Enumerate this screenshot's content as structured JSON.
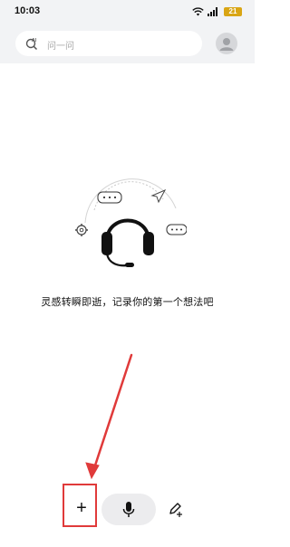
{
  "status_bar": {
    "time": "10:03",
    "battery": "21",
    "icons": [
      "wifi-icon",
      "signal-icon",
      "battery-icon"
    ]
  },
  "header": {
    "search": {
      "icon": "ai-search-icon",
      "placeholder": "问一问"
    },
    "avatar": {
      "icon": "user-avatar-icon"
    }
  },
  "main": {
    "empty_state_text": "灵感转瞬即逝，记录你的第一个想法吧",
    "illustration": "headphones-icon"
  },
  "bottom_bar": {
    "add_label": "+",
    "mic_icon": "microphone-icon",
    "pen_icon": "pen-text-icon"
  },
  "annotation": {
    "highlight_color": "#e03a3a"
  }
}
